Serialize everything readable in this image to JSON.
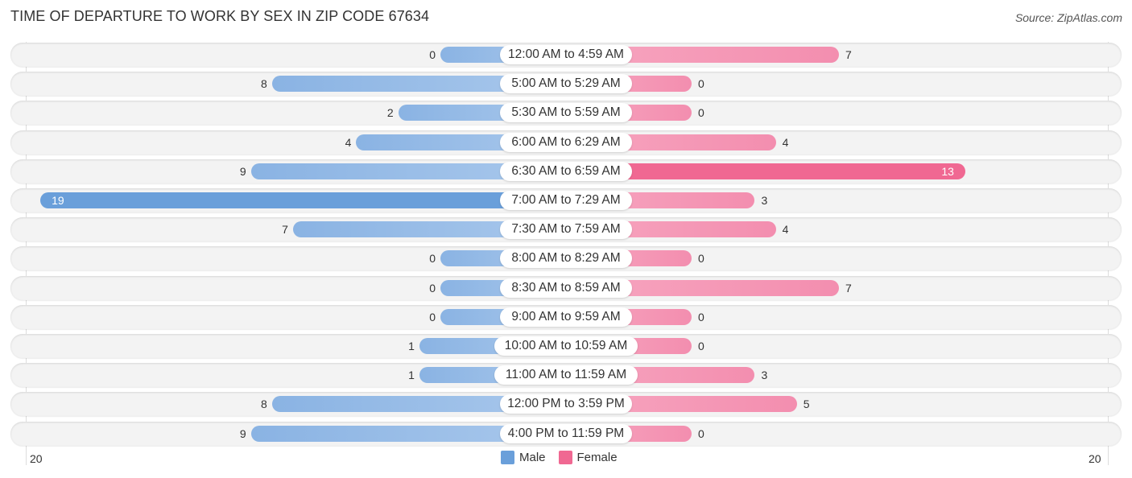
{
  "header": {
    "title": "TIME OF DEPARTURE TO WORK BY SEX IN ZIP CODE 67634",
    "source": "Source: ZipAtlas.com"
  },
  "colors": {
    "male": "#6a9fda",
    "female": "#f06892"
  },
  "chart_data": {
    "type": "bar",
    "orientation": "horizontal-diverging",
    "title": "TIME OF DEPARTURE TO WORK BY SEX IN ZIP CODE 67634",
    "categories": [
      "12:00 AM to 4:59 AM",
      "5:00 AM to 5:29 AM",
      "5:30 AM to 5:59 AM",
      "6:00 AM to 6:29 AM",
      "6:30 AM to 6:59 AM",
      "7:00 AM to 7:29 AM",
      "7:30 AM to 7:59 AM",
      "8:00 AM to 8:29 AM",
      "8:30 AM to 8:59 AM",
      "9:00 AM to 9:59 AM",
      "10:00 AM to 10:59 AM",
      "11:00 AM to 11:59 AM",
      "12:00 PM to 3:59 PM",
      "4:00 PM to 11:59 PM"
    ],
    "series": [
      {
        "name": "Male",
        "values": [
          0,
          8,
          2,
          4,
          9,
          19,
          7,
          0,
          0,
          0,
          1,
          1,
          8,
          9
        ]
      },
      {
        "name": "Female",
        "values": [
          7,
          0,
          0,
          4,
          13,
          3,
          4,
          0,
          7,
          0,
          0,
          3,
          5,
          0
        ]
      }
    ],
    "axis": {
      "left_label": "20",
      "right_label": "20",
      "max": 20
    },
    "legend": {
      "position": "bottom-center",
      "entries": [
        "Male",
        "Female"
      ]
    }
  }
}
